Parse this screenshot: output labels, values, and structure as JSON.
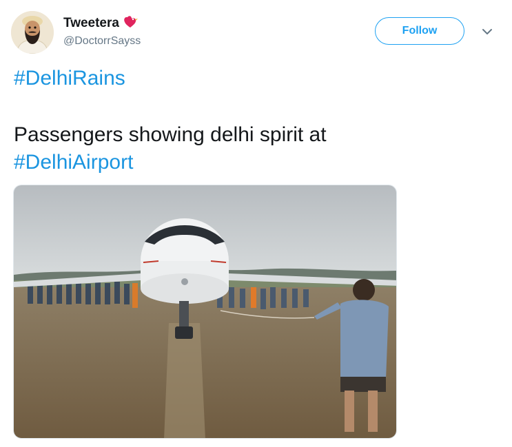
{
  "user": {
    "display_name": "Tweetera",
    "handle": "@DoctorrSayss"
  },
  "actions": {
    "follow_label": "Follow"
  },
  "tweet": {
    "hashtag_line": "#DelhiRains",
    "text_line1": "Passengers showing delhi spirit at",
    "text_tag": "#DelhiAirport"
  },
  "colors": {
    "link": "#1b95e0",
    "follow_border": "#1da1f2",
    "handle_gray": "#657786",
    "text": "#14171a"
  },
  "icons": {
    "badge": "bird-heart-icon",
    "caret": "chevron-down-icon"
  }
}
